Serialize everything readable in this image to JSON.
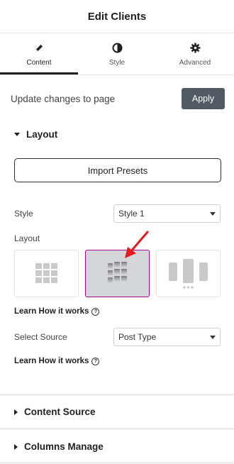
{
  "header": {
    "title": "Edit Clients"
  },
  "tabs": [
    {
      "label": "Content",
      "icon": "pencil-icon",
      "active": true
    },
    {
      "label": "Style",
      "icon": "contrast-icon",
      "active": false
    },
    {
      "label": "Advanced",
      "icon": "gear-icon",
      "active": false
    }
  ],
  "update": {
    "label": "Update changes to page",
    "button": "Apply"
  },
  "layout_section": {
    "title": "Layout",
    "import_button": "Import Presets",
    "style_label": "Style",
    "style_value": "Style 1",
    "layout_label": "Layout",
    "layout_options": [
      "grid",
      "carousel",
      "slider"
    ],
    "selected_layout": "carousel",
    "learn_1": "Learn How it works",
    "source_label": "Select Source",
    "source_value": "Post Type",
    "learn_2": "Learn How it works"
  },
  "sections": [
    {
      "title": "Content Source"
    },
    {
      "title": "Columns Manage"
    }
  ],
  "colors": {
    "accent": "#a10c8d",
    "apply_bg": "#515962",
    "arrow": "#e31b1b"
  }
}
